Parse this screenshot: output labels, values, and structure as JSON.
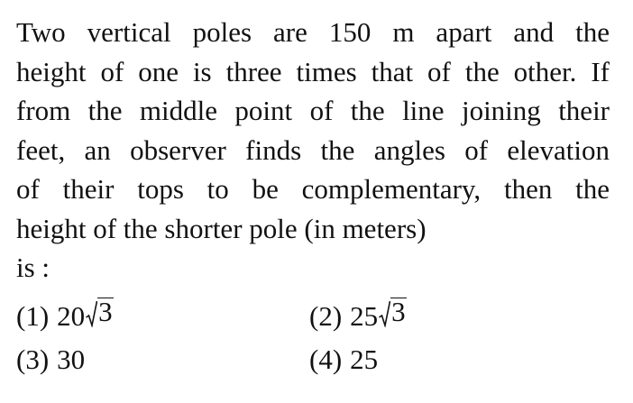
{
  "question": {
    "lines": [
      "Two vertical poles are 150 m apart and the",
      "height of one is three times that of the other. If",
      "from the middle point of the line joining their",
      "feet, an observer finds the angles of elevation",
      "of their tops to be complementary, then the",
      "height of the shorter pole (in meters)",
      "is :"
    ]
  },
  "options": [
    {
      "number": "(1)",
      "coefficient": "20",
      "radicand": "3"
    },
    {
      "number": "(2)",
      "coefficient": "25",
      "radicand": "3"
    },
    {
      "number": "(3)",
      "value": "30"
    },
    {
      "number": "(4)",
      "value": "25"
    }
  ]
}
